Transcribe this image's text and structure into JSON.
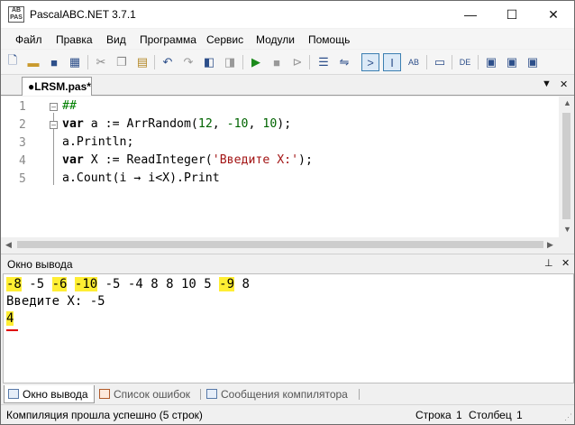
{
  "window": {
    "title": "PascalABC.NET 3.7.1",
    "icon_text": "AB PAS",
    "controls": {
      "minimize": "—",
      "maximize": "☐",
      "close": "✕"
    }
  },
  "menu": [
    "Файл",
    "Правка",
    "Вид",
    "Программа",
    "Сервис",
    "Модули",
    "Помощь"
  ],
  "toolbar_icons": [
    "new-file-icon",
    "open-folder-icon",
    "save-icon",
    "save-all-icon",
    "cut-icon",
    "copy-icon",
    "paste-icon",
    "undo-icon",
    "redo-icon",
    "back-icon",
    "forward-icon",
    "run-icon",
    "stop-icon",
    "step-icon",
    "watch-icon",
    "console-icon",
    "form-icon",
    "calc-icon",
    "format-icon",
    "code-icon",
    "debug-icon",
    "help-icon",
    "break-icon"
  ],
  "editor_tab": {
    "label": "●LRSM.pas*",
    "dropdown": "▼",
    "close": "✕"
  },
  "editor": {
    "line_numbers": [
      "1",
      "2",
      "3",
      "4",
      "5"
    ],
    "lines": [
      [
        {
          "t": "##",
          "c": "cmt"
        }
      ],
      [
        {
          "t": "var",
          "c": "kw"
        },
        {
          "t": " a := ArrRandom(",
          "c": ""
        },
        {
          "t": "12",
          "c": "num"
        },
        {
          "t": ", ",
          "c": ""
        },
        {
          "t": "-10",
          "c": "num"
        },
        {
          "t": ", ",
          "c": ""
        },
        {
          "t": "10",
          "c": "num"
        },
        {
          "t": ");",
          "c": ""
        }
      ],
      [
        {
          "t": "a.Println;",
          "c": ""
        }
      ],
      [
        {
          "t": "var",
          "c": "kw"
        },
        {
          "t": " X := ReadInteger(",
          "c": ""
        },
        {
          "t": "'Введите X:'",
          "c": "str"
        },
        {
          "t": ");",
          "c": ""
        }
      ],
      [
        {
          "t": "a.Count(i → i<X).Print",
          "c": ""
        }
      ]
    ]
  },
  "output_panel": {
    "title": "Окно вывода",
    "pin": "⊥",
    "close": "✕",
    "numbers": [
      "-8",
      "-5",
      "-6",
      "-10",
      "-5",
      "-4",
      "8",
      "8",
      "10",
      "5",
      "-9",
      "8"
    ],
    "highlighted": [
      true,
      false,
      true,
      true,
      false,
      false,
      false,
      false,
      false,
      false,
      true,
      false
    ],
    "prompt_line": "Введите X: -5",
    "result": "4"
  },
  "bottom_tabs": [
    "Окно вывода",
    "Список ошибок",
    "Сообщения компилятора"
  ],
  "status": {
    "message": "Компиляция прошла успешно (5 строк)",
    "row_label": "Строка",
    "row_value": "1",
    "col_label": "Столбец",
    "col_value": "1"
  },
  "colors": {
    "highlight": "#ffee33",
    "keyword": "#000000",
    "number": "#006400",
    "string": "#a31515",
    "comment": "#008000",
    "selection_border": "#3c7fb1"
  }
}
